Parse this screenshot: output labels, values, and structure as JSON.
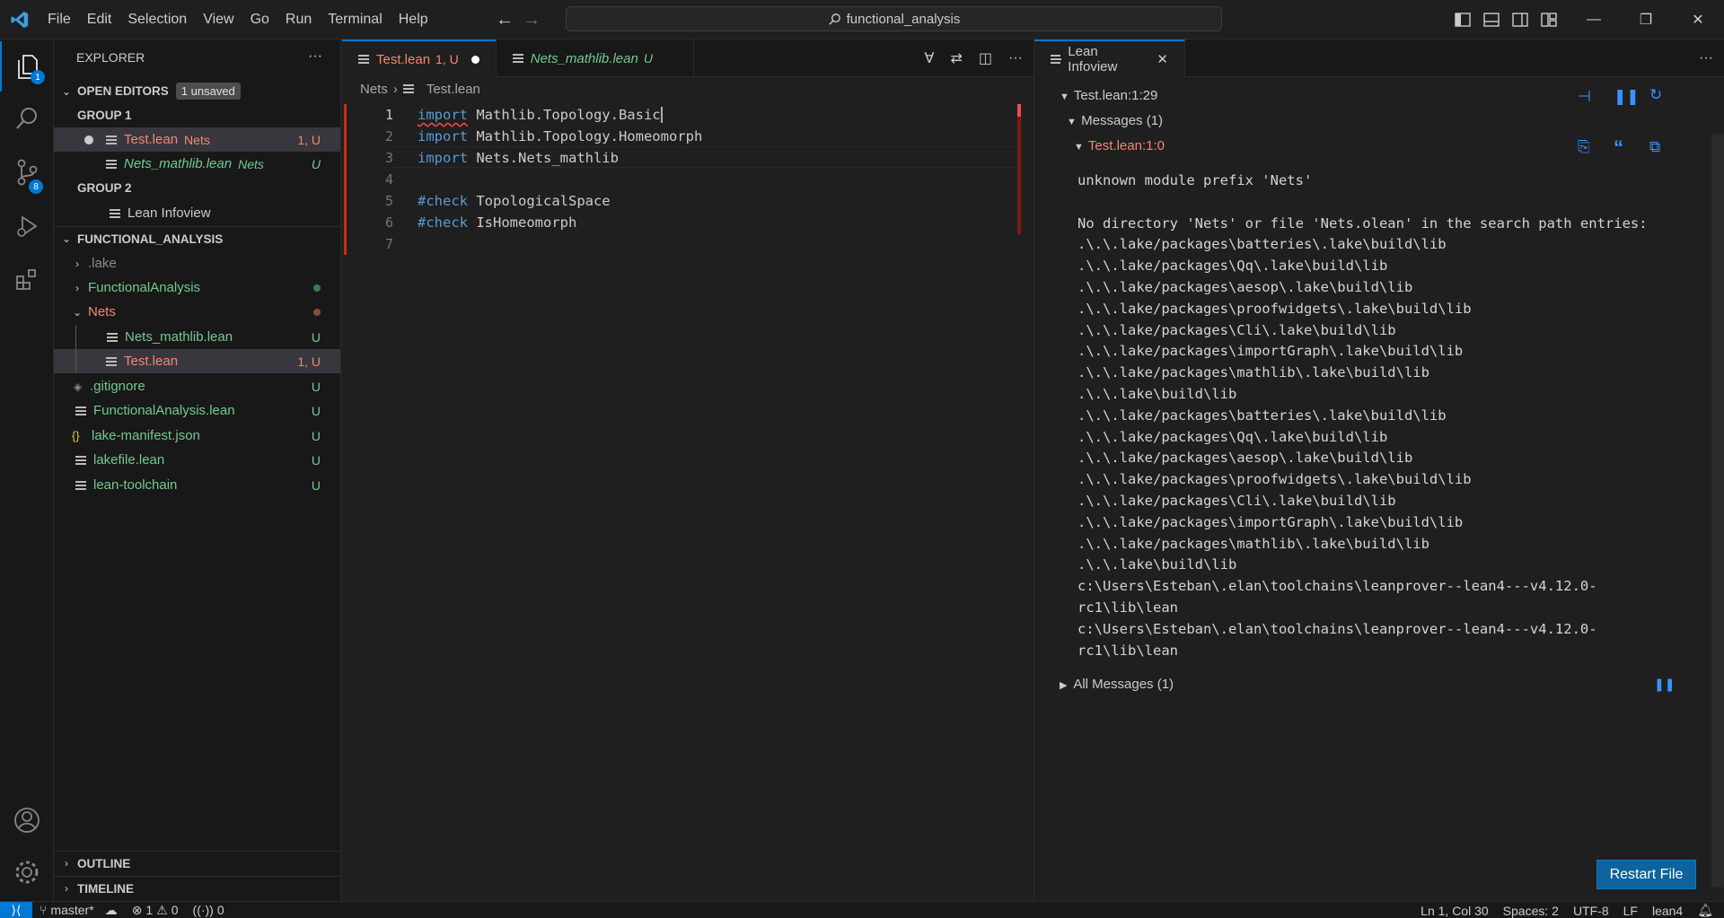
{
  "window": {
    "search_text": "functional_analysis",
    "menu": [
      "File",
      "Edit",
      "Selection",
      "View",
      "Go",
      "Run",
      "Terminal",
      "Help"
    ]
  },
  "activity": {
    "explorer_badge": "1",
    "scm_badge": "8"
  },
  "sidebar": {
    "title": "EXPLORER",
    "open_editors": {
      "label": "OPEN EDITORS",
      "unsaved": "1 unsaved",
      "group1": "GROUP 1",
      "group2": "GROUP 2",
      "items": [
        {
          "name": "Test.lean",
          "folder": "Nets",
          "status": "1, U"
        },
        {
          "name": "Nets_mathlib.lean",
          "folder": "Nets",
          "status": "U"
        },
        {
          "name": "Lean Infoview"
        }
      ]
    },
    "workspace": {
      "label": "FUNCTIONAL_ANALYSIS",
      "items": [
        {
          "name": ".lake",
          "status": ""
        },
        {
          "name": "FunctionalAnalysis",
          "status": ""
        },
        {
          "name": "Nets",
          "status": ""
        },
        {
          "name": "Nets_mathlib.lean",
          "status": "U"
        },
        {
          "name": "Test.lean",
          "status": "1, U"
        },
        {
          "name": ".gitignore",
          "status": "U"
        },
        {
          "name": "FunctionalAnalysis.lean",
          "status": "U"
        },
        {
          "name": "lake-manifest.json",
          "status": "U"
        },
        {
          "name": "lakefile.lean",
          "status": "U"
        },
        {
          "name": "lean-toolchain",
          "status": "U"
        }
      ]
    },
    "outline": "OUTLINE",
    "timeline": "TIMELINE"
  },
  "editor": {
    "tabs": [
      {
        "label": "Test.lean",
        "status": "1, U"
      },
      {
        "label": "Nets_mathlib.lean",
        "status": "U"
      }
    ],
    "breadcrumb": [
      "Nets",
      "Test.lean"
    ],
    "lines": [
      {
        "n": "1",
        "kw": "import",
        "rest": " Mathlib.Topology.Basic"
      },
      {
        "n": "2",
        "kw": "import",
        "rest": " Mathlib.Topology.Homeomorph"
      },
      {
        "n": "3",
        "kw": "import",
        "rest": " Nets.Nets_mathlib"
      },
      {
        "n": "4",
        "kw": "",
        "rest": ""
      },
      {
        "n": "5",
        "kw": "#check",
        "rest": " TopologicalSpace"
      },
      {
        "n": "6",
        "kw": "#check",
        "rest": " IsHomeomorph"
      },
      {
        "n": "7",
        "kw": "",
        "rest": ""
      }
    ]
  },
  "infoview": {
    "tab": "Lean Infoview",
    "position": "Test.lean:1:29",
    "messages_label": "Messages (1)",
    "message_loc": "Test.lean:1:0",
    "message_text": "unknown module prefix 'Nets'\n\nNo directory 'Nets' or file 'Nets.olean' in the search path entries:\n.\\.\\.lake/packages\\batteries\\.lake\\build\\lib\n.\\.\\.lake/packages\\Qq\\.lake\\build\\lib\n.\\.\\.lake/packages\\aesop\\.lake\\build\\lib\n.\\.\\.lake/packages\\proofwidgets\\.lake\\build\\lib\n.\\.\\.lake/packages\\Cli\\.lake\\build\\lib\n.\\.\\.lake/packages\\importGraph\\.lake\\build\\lib\n.\\.\\.lake/packages\\mathlib\\.lake\\build\\lib\n.\\.\\.lake\\build\\lib\n.\\.\\.lake/packages\\batteries\\.lake\\build\\lib\n.\\.\\.lake/packages\\Qq\\.lake\\build\\lib\n.\\.\\.lake/packages\\aesop\\.lake\\build\\lib\n.\\.\\.lake/packages\\proofwidgets\\.lake\\build\\lib\n.\\.\\.lake/packages\\Cli\\.lake\\build\\lib\n.\\.\\.lake/packages\\importGraph\\.lake\\build\\lib\n.\\.\\.lake/packages\\mathlib\\.lake\\build\\lib\n.\\.\\.lake\\build\\lib\nc:\\Users\\Esteban\\.elan\\toolchains\\leanprover--lean4---v4.12.0-\nrc1\\lib\\lean\nc:\\Users\\Esteban\\.elan\\toolchains\\leanprover--lean4---v4.12.0-\nrc1\\lib\\lean",
    "all_messages": "All Messages (1)",
    "restart": "Restart File"
  },
  "status": {
    "branch": "master*",
    "errors": "1",
    "warnings": "0",
    "ports": "0",
    "position": "Ln 1, Col 30",
    "spaces": "Spaces: 2",
    "encoding": "UTF-8",
    "eol": "LF",
    "language": "lean4"
  },
  "colors": {
    "accent": "#0078d4",
    "error": "#f48771",
    "untracked": "#73c991",
    "keyword": "#569cd6"
  }
}
